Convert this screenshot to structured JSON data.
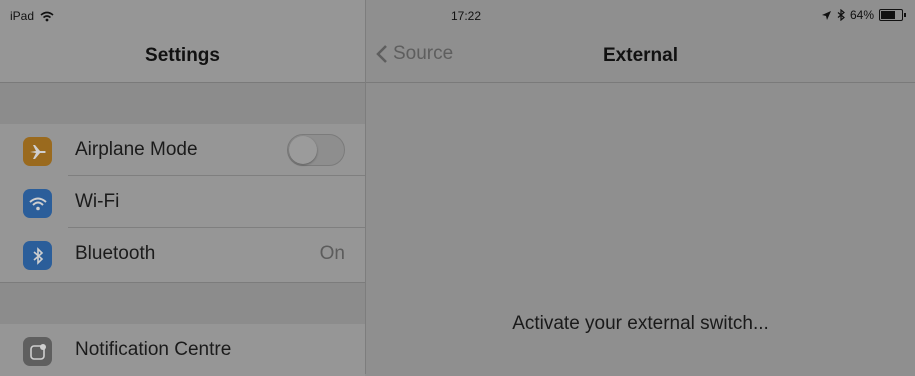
{
  "status_bar": {
    "device": "iPad",
    "time": "17:22",
    "battery": "64%"
  },
  "left_pane": {
    "title": "Settings",
    "rows": [
      {
        "label": "Airplane Mode",
        "icon": "airplane-icon",
        "icon_color": "#9a6a1e",
        "control": "toggle",
        "toggle_on": false
      },
      {
        "label": "Wi-Fi",
        "icon": "wifi-icon",
        "icon_color": "#2b5e9a"
      },
      {
        "label": "Bluetooth",
        "icon": "bluetooth-icon",
        "icon_color": "#2b5e9a",
        "value": "On"
      },
      {
        "label": "Notification Centre",
        "icon": "notification-centre-icon",
        "icon_color": "#5f5f5f"
      }
    ]
  },
  "right_pane": {
    "back_label": "Source",
    "title": "External",
    "message": "Activate your external switch..."
  }
}
